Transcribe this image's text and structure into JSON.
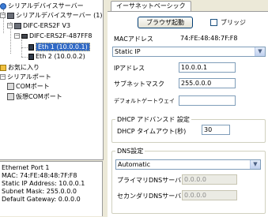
{
  "tree": {
    "root_label": "シリアルデバイスサーバー",
    "servers_label": "シリアルデバイスサーバー (1)",
    "device_label": "DIFC-ERS2F V3",
    "mac_label": "DIFC-ERS2F-487FF8",
    "eth1_label": "Eth 1 (10.0.0.1)",
    "eth2_label": "Eth 2 (10.0.0.2)",
    "favorites_label": "お気に入り",
    "serial_ports_label": "シリアルポート",
    "com_port_label": "COMポート",
    "virtual_com_label": "仮想COMポート"
  },
  "info": {
    "line1": "Ethernet Port 1",
    "line2": "MAC: 74:FE:48:48:7F:F8",
    "line3": "Static IP Address: 10.0.0.1",
    "line4": "Subnet Mask: 255.0.0.0",
    "line5": "Default Gateway: 0.0.0.0"
  },
  "tab": {
    "label": "イーサネットベーシック"
  },
  "browser_button": "ブラウザ起動",
  "bridge": {
    "label": "ブリッジ",
    "checked": false
  },
  "mac": {
    "label": "MACアドレス",
    "value": "74:FE:48:48:7F:F8"
  },
  "ip_mode": {
    "selected": "Static IP"
  },
  "ip_address": {
    "label": "IPアドレス",
    "value": "10.0.0.1"
  },
  "subnet_mask": {
    "label": "サブネットマスク",
    "value": "255.0.0.0"
  },
  "default_gateway": {
    "label": "デフォルトゲートウェイ",
    "value": ""
  },
  "dhcp_advanced": {
    "title": "DHCP アドバンスド 設定",
    "timeout_label": "DHCP タイムアウト(秒)",
    "timeout_value": "30"
  },
  "dns": {
    "title": "DNS設定",
    "mode_selected": "Automatic",
    "primary_label": "プライマリDNSサーバ",
    "primary_value": "0.0.0.0",
    "secondary_label": "セカンダリDNSサーバ",
    "secondary_value": "0.0.0.0"
  },
  "colors": {
    "selection": "#316ac5",
    "window_bg": "#ece9d8"
  }
}
